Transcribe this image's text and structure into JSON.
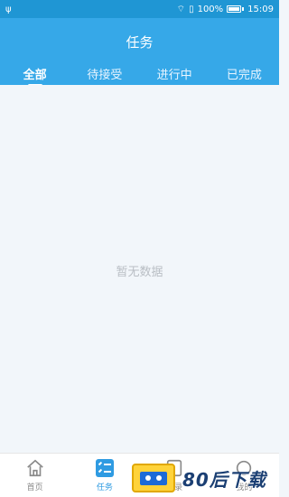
{
  "status_bar": {
    "usb_icon": "usb-icon",
    "battery_percent": "100%",
    "time": "15:09"
  },
  "header": {
    "title": "任务"
  },
  "tabs": [
    {
      "label": "全部",
      "active": true
    },
    {
      "label": "待接受",
      "active": false
    },
    {
      "label": "进行中",
      "active": false
    },
    {
      "label": "已完成",
      "active": false
    }
  ],
  "content": {
    "empty_text": "暂无数据"
  },
  "bottom_nav": [
    {
      "label": "首页",
      "icon": "home-icon",
      "active": false
    },
    {
      "label": "任务",
      "icon": "task-icon",
      "active": true
    },
    {
      "label": "讯录",
      "icon": "contacts-icon",
      "active": false
    },
    {
      "label": "我的",
      "icon": "profile-icon",
      "active": false
    }
  ],
  "watermark": {
    "text": "80后下载"
  },
  "colors": {
    "header": "#36a8e8",
    "status_bar": "#1f96d4",
    "active_nav": "#2f9be2",
    "background": "#f2f6fa"
  }
}
